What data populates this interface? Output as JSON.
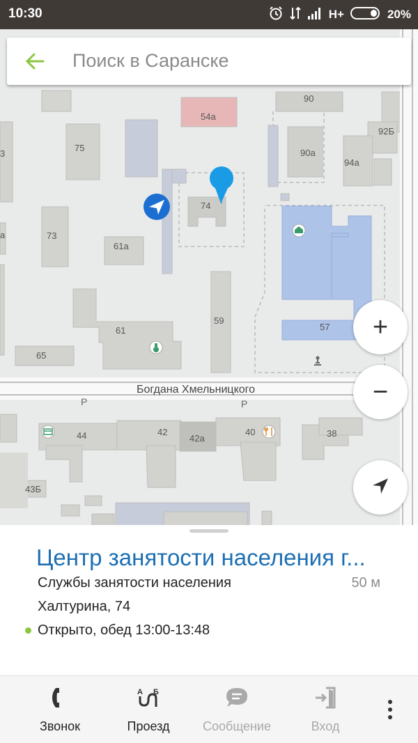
{
  "status_bar": {
    "time": "10:30",
    "network": "H+",
    "battery": "20%"
  },
  "search": {
    "placeholder": "Поиск в Саранске"
  },
  "map": {
    "street": "Богдана Хмельницкого",
    "parking_labels": [
      "P",
      "P"
    ],
    "house_numbers": [
      "54а",
      "90",
      "92Б",
      "75",
      "90а",
      "94а",
      "74",
      "73",
      "61а",
      "59",
      "57",
      "61",
      "65",
      "44",
      "42",
      "42а",
      "40",
      "38",
      "43Б",
      "3",
      "а"
    ]
  },
  "controls": {
    "zoom_in": "+",
    "zoom_out": "−"
  },
  "card": {
    "title": "Центр занятости населения г...",
    "category": "Службы занятости населения",
    "distance": "50 м",
    "address": "Халтурина, 74",
    "hours": "Открыто, обед 13:00-13:48",
    "status_color": "#8cc63f"
  },
  "actions": [
    {
      "label": "Звонок",
      "icon": "phone-icon",
      "enabled": true
    },
    {
      "label": "Проезд",
      "icon": "route-icon",
      "enabled": true
    },
    {
      "label": "Сообщение",
      "icon": "message-icon",
      "enabled": false
    },
    {
      "label": "Вход",
      "icon": "entrance-icon",
      "enabled": false
    }
  ],
  "colors": {
    "title_blue": "#1c6fb3",
    "accent_green": "#8cc63f",
    "marker_blue": "#1a9be6",
    "status_bar": "#3f3a36"
  }
}
